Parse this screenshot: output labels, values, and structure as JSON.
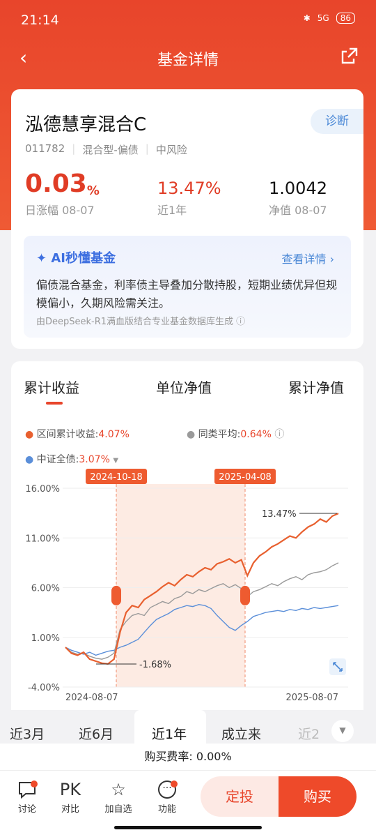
{
  "status_bar": {
    "time": "21:14",
    "battery": "86",
    "signal": "5G"
  },
  "nav": {
    "title": "基金详情"
  },
  "fund": {
    "name": "泓德慧享混合C",
    "diagnose_label": "诊断",
    "code": "011782",
    "category": "混合型-偏债",
    "risk": "中风险",
    "daily_change": "0.03",
    "daily_change_unit": "%",
    "daily_change_label": "日涨幅 08-07",
    "year_return": "13.47%",
    "year_return_label": "近1年",
    "nav_value": "1.0042",
    "nav_label": "净值 08-07"
  },
  "ai": {
    "title": "AI秒懂基金",
    "more": "查看详情",
    "text": "偏债混合基金，利率债主导叠加分散持股，短期业绩优异但规模偏小，久期风险需关注。",
    "footer": "由DeepSeek-R1满血版结合专业基金数据库生成"
  },
  "chart_tabs": [
    "累计收益",
    "单位净值",
    "累计净值"
  ],
  "legend": {
    "fund_label": "区间累计收益:",
    "fund_value": "4.07%",
    "avg_label": "同类平均:",
    "avg_value": "0.64%",
    "bench_label": "中证全债:",
    "bench_value": "3.07%"
  },
  "chart_data": {
    "type": "line",
    "yticks": [
      "16.00%",
      "11.00%",
      "6.00%",
      "1.00%",
      "-4.00%"
    ],
    "ylim": [
      -4,
      16
    ],
    "x_start": "2024-08-07",
    "x_end": "2025-08-07",
    "range_start_label": "2024-10-18",
    "range_end_label": "2025-04-08",
    "annotations": {
      "max": "13.47%",
      "min": "-1.68%"
    },
    "series": [
      {
        "values": [
          0.0,
          -0.6,
          -0.8,
          -0.5,
          -1.2,
          -1.4,
          -1.6,
          -1.68,
          -1.2,
          1.5,
          3.5,
          4.2,
          4.0,
          4.8,
          5.2,
          5.6,
          6.1,
          6.5,
          6.2,
          6.8,
          7.3,
          7.1,
          7.6,
          8.0,
          7.8,
          8.4,
          8.6,
          8.9,
          8.5,
          8.8,
          7.2,
          8.5,
          9.2,
          9.6,
          10.1,
          10.4,
          10.8,
          11.2,
          11.0,
          11.6,
          12.1,
          12.4,
          12.9,
          12.6,
          13.2,
          13.47
        ],
        "color": "#e8602f"
      },
      {
        "values": [
          0.0,
          -0.5,
          -0.7,
          -0.6,
          -0.9,
          -1.1,
          -1.2,
          -1.0,
          -0.6,
          1.8,
          2.6,
          3.2,
          3.4,
          3.2,
          4.0,
          4.3,
          4.6,
          4.4,
          4.9,
          5.1,
          5.6,
          5.4,
          5.8,
          5.6,
          5.9,
          6.2,
          6.4,
          6.0,
          6.3,
          5.9,
          5.1,
          5.6,
          5.8,
          6.1,
          6.4,
          6.2,
          6.6,
          6.9,
          7.1,
          6.8,
          7.3,
          7.5,
          7.6,
          7.8,
          8.2,
          8.5
        ],
        "color": "#9a9a9a"
      },
      {
        "values": [
          0.0,
          -0.3,
          -0.5,
          -0.7,
          -0.5,
          -0.8,
          -0.6,
          -0.4,
          -0.3,
          0.0,
          0.2,
          0.5,
          0.8,
          1.5,
          2.2,
          2.8,
          3.1,
          3.4,
          3.8,
          4.0,
          4.2,
          4.1,
          4.3,
          4.2,
          3.9,
          3.2,
          2.6,
          2.0,
          1.7,
          2.2,
          2.6,
          3.1,
          3.3,
          3.5,
          3.6,
          3.7,
          3.6,
          3.8,
          3.7,
          3.9,
          3.8,
          4.0,
          3.9,
          4.0,
          4.1,
          4.2
        ],
        "color": "#5b8fd9"
      }
    ]
  },
  "periods": [
    "近3月",
    "近6月",
    "近1年",
    "成立来",
    "近2"
  ],
  "fee": "购买费率: 0.00%",
  "bottom_nav": [
    "讨论",
    "对比",
    "加自选",
    "功能"
  ],
  "pk_label": "PK",
  "buttons": {
    "regular": "定投",
    "buy": "购买"
  }
}
